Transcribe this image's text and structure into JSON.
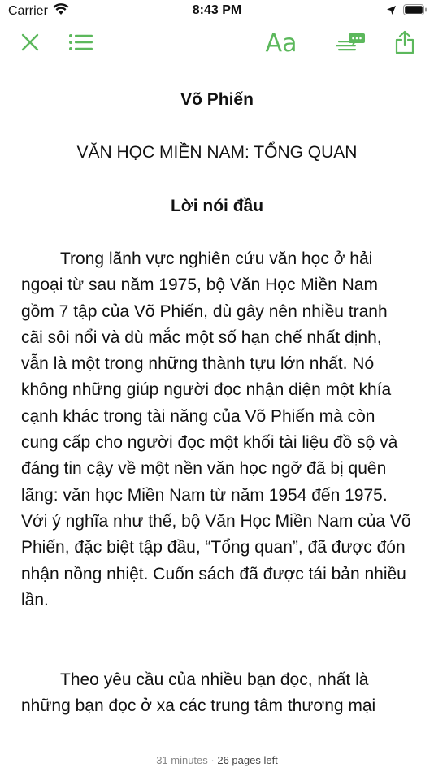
{
  "status": {
    "carrier": "Carrier",
    "time": "8:43 PM"
  },
  "toolbar": {
    "accent": "#5cb85c",
    "font_label": "Aa"
  },
  "book": {
    "author": "Võ Phiến",
    "title": "VĂN HỌC MIỀN NAM: TỔNG QUAN",
    "section_heading": "Lời nói đầu",
    "paragraphs": [
      "Trong lãnh vực nghiên cứu văn học ở hải ngoại từ sau năm 1975, bộ Văn Học Miền Nam gồm 7 tập của Võ Phiến, dù gây nên nhiều tranh cãi sôi nổi và dù mắc một số hạn chế nhất định, vẫn là một trong những thành tựu lớn nhất. Nó không những giúp người đọc nhận diện một khía cạnh khác trong tài năng của Võ Phiến mà còn cung cấp cho người đọc một khối tài liệu đồ sộ và đáng tin cậy về một nền văn học ngỡ đã bị quên lãng: văn học Miền Nam từ năm 1954 đến 1975. Với ý nghĩa như thế, bộ Văn Học Miền Nam của Võ Phiến, đặc biệt tập đầu, “Tổng quan”, đã được đón nhận nồng nhiệt. Cuốn sách đã được tái bản nhiều lần.",
      "Theo yêu cầu của nhiều bạn đọc, nhất là những bạn đọc ở xa các trung tâm thương mại"
    ]
  },
  "footer": {
    "time_left": "31 minutes",
    "separator": " · ",
    "pages_left": "26 pages left"
  }
}
